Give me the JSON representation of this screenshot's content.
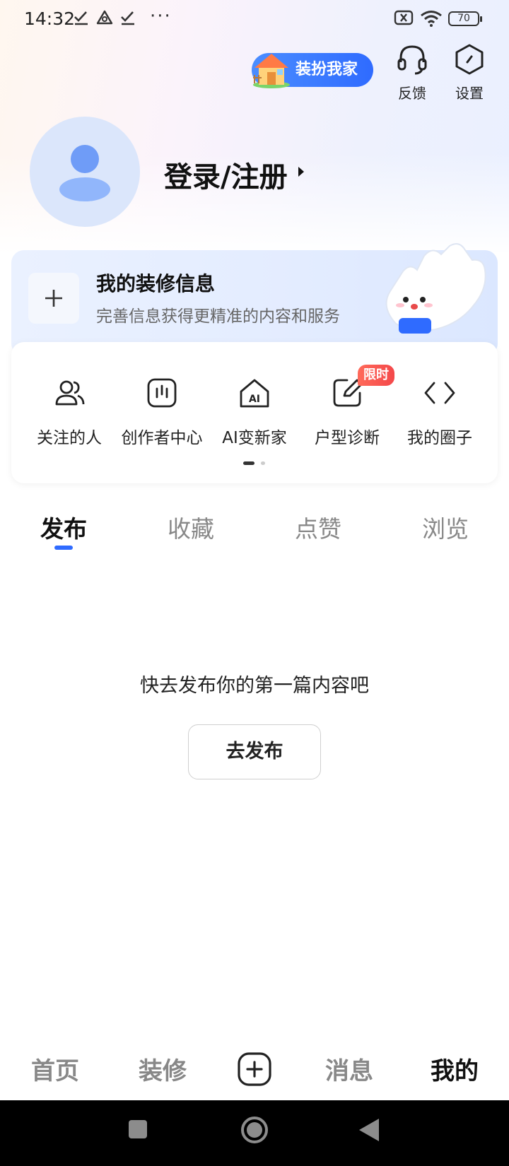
{
  "status_bar": {
    "time": "14:32",
    "battery": "70"
  },
  "header": {
    "dress_up_label": "装扮我家",
    "feedback_label": "反馈",
    "settings_label": "设置"
  },
  "profile": {
    "login_label": "登录/注册"
  },
  "deco_info": {
    "title": "我的装修信息",
    "subtitle": "完善信息获得更精准的内容和服务"
  },
  "quick_actions": [
    {
      "label": "关注的人",
      "icon": "people-icon"
    },
    {
      "label": "创作者中心",
      "icon": "creator-icon"
    },
    {
      "label": "AI变新家",
      "icon": "ai-house-icon"
    },
    {
      "label": "户型诊断",
      "icon": "edit-icon",
      "badge": "限时"
    },
    {
      "label": "我的圈子",
      "icon": "code-brackets-icon"
    }
  ],
  "tabs": [
    "发布",
    "收藏",
    "点赞",
    "浏览"
  ],
  "active_tab": "发布",
  "empty_state": {
    "message": "快去发布你的第一篇内容吧",
    "button_label": "去发布"
  },
  "bottom_nav": [
    "首页",
    "装修",
    "消息",
    "我的"
  ],
  "active_nav": "我的",
  "colors": {
    "accent": "#2f6bff",
    "badge": "#f4484a"
  }
}
